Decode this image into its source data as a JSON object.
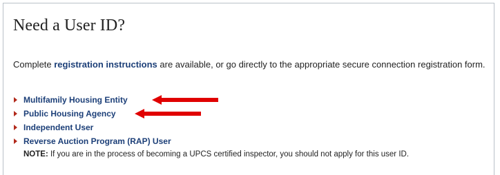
{
  "title": "Need a User ID?",
  "intro": {
    "prefix": "Complete ",
    "link": "registration instructions",
    "suffix": " are available, or go directly to the appropriate secure connection registration form."
  },
  "links": [
    {
      "label": "Multifamily Housing Entity",
      "highlighted": true
    },
    {
      "label": "Public Housing Agency",
      "highlighted": true
    },
    {
      "label": "Independent User",
      "highlighted": false
    },
    {
      "label": "Reverse Auction Program (RAP) User",
      "highlighted": false
    }
  ],
  "note": {
    "label": "NOTE:",
    "text": " If you are in the process of becoming a UPCS certified inspector, you should not apply for this user ID."
  },
  "colors": {
    "link": "#1c3f78",
    "bullet": "#b22a1c",
    "annotation_arrow": "#e00000"
  },
  "icons": {
    "bullet": "triangle-right-icon",
    "annotation": "arrow-left-icon"
  }
}
